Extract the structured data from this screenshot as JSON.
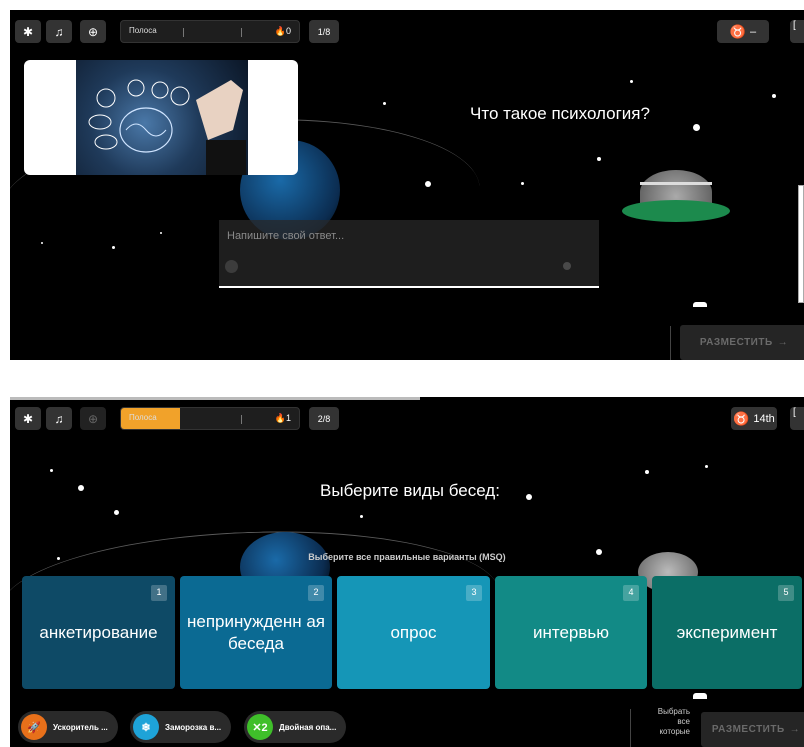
{
  "screen1": {
    "toolbar": {
      "settings_icon": "gear-icon",
      "music_icon": "music-note-icon",
      "zoom_icon": "zoom-in-icon",
      "progress_label": "Полоса",
      "progress_fraction": 0.0,
      "streak_value": "0",
      "question_counter": "1/8",
      "rank": "–"
    },
    "question": "Что такое психология?",
    "answer_placeholder": "Напишите свой ответ...",
    "submit_label": "РАЗМЕСТИТЬ"
  },
  "screen2": {
    "toolbar": {
      "settings_icon": "gear-icon",
      "music_icon": "music-note-icon",
      "zoom_icon": "zoom-in-icon",
      "progress_label": "Полоса",
      "progress_fraction": 0.33,
      "streak_value": "1",
      "question_counter": "2/8",
      "rank": "14th"
    },
    "question": "Выберите виды бесед:",
    "hint": "Выберите все правильные варианты (MSQ)",
    "options": [
      {
        "number": "1",
        "text": "анкетирование",
        "color": "#0e4a66"
      },
      {
        "number": "2",
        "text": "непринужденн ая беседа",
        "color": "#0b6a93"
      },
      {
        "number": "3",
        "text": "опрос",
        "color": "#1596b7"
      },
      {
        "number": "4",
        "text": "интервью",
        "color": "#128a86"
      },
      {
        "number": "5",
        "text": "эксперимент",
        "color": "#0b6e66"
      }
    ],
    "powerups": [
      {
        "label": "Ускоритель ...",
        "icon": "rocket-icon",
        "color": "#e8701a"
      },
      {
        "label": "Заморозка в...",
        "icon": "snowflake-icon",
        "color": "#1ea3d8"
      },
      {
        "label": "Двойная опа...",
        "icon": "double-icon",
        "color": "#3fbf2a"
      }
    ],
    "select_all_lines": [
      "Выбрать",
      "все",
      "которые"
    ],
    "submit_label": "РАЗМЕСТИТЬ"
  }
}
